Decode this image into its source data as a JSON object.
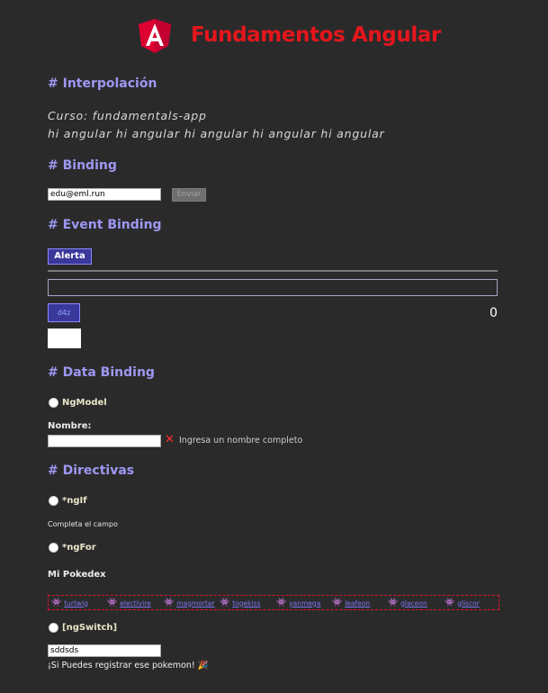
{
  "header": {
    "title": "Fundamentos Angular"
  },
  "sections": {
    "interpolation": {
      "title": "# Interpolación",
      "course": "Curso: fundamentals-app",
      "repeat": "hi angular hi angular hi angular hi angular hi angular"
    },
    "binding": {
      "title": "# Binding",
      "email_value": "edu@eml.run",
      "send_label": "Enviar"
    },
    "event_binding": {
      "title": "# Event Binding",
      "alert_label": "Alerta",
      "small_button_label": "d4z",
      "counter": "0"
    },
    "data_binding": {
      "title": "# Data Binding",
      "ngmodel_label": "NgModel",
      "name_label": "Nombre:",
      "name_value": "",
      "error_text": "Ingresa un nombre completo"
    },
    "directives": {
      "title": "# Directivas",
      "ngif_label": "*ngIf",
      "ngif_message": "Completa el campo",
      "ngfor_label": "*ngFor",
      "pokedex_title": "Mi Pokedex",
      "pokemon": [
        "turtwig",
        "electivire",
        "magmortar",
        "togekiss",
        "yanmega",
        "leafeon",
        "glaceon",
        "gliscor"
      ],
      "ngswitch_label": "[ngSwitch]",
      "switch_value": "sddsds",
      "switch_message": "¡Si Puedes registrar ese pokemon! 🎉"
    }
  }
}
